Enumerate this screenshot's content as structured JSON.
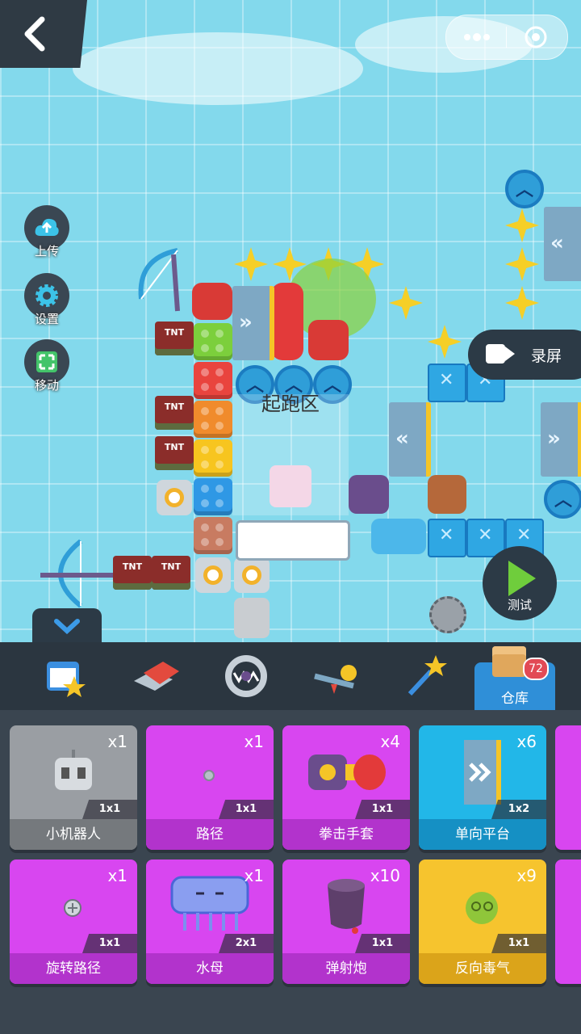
{
  "colors": {
    "sky": "#83d9ec",
    "panel_dark": "#2b3640",
    "card_gray": "#9a9ea3",
    "card_magenta": "#d846f0",
    "card_cyan": "#22b7e8",
    "card_yellow": "#f6c42e",
    "warehouse_blue": "#2f8fd8",
    "play_green": "#6fcd3c"
  },
  "top_bar": {
    "back_icon": "chevron-left-icon",
    "more_icon": "more-dots-icon",
    "close_icon": "target-circle-icon"
  },
  "side_menu": [
    {
      "label": "上传",
      "icon": "cloud-upload-icon"
    },
    {
      "label": "设置",
      "icon": "gear-icon"
    },
    {
      "label": "移动",
      "icon": "move-arrows-icon"
    }
  ],
  "board": {
    "start_zone_label": "起跑区",
    "tnt_text": "TNT"
  },
  "record_button": {
    "label": "录屏",
    "icon": "video-camera-icon"
  },
  "test_button": {
    "label": "测试",
    "icon": "play-icon"
  },
  "toolbar": {
    "tabs": [
      {
        "icon": "calendar-star-icon"
      },
      {
        "icon": "eraser-block-icon"
      },
      {
        "icon": "trap-jaw-icon"
      },
      {
        "icon": "seesaw-ball-icon"
      },
      {
        "icon": "magic-wand-icon"
      }
    ],
    "warehouse_label": "仓库",
    "warehouse_count": "72"
  },
  "inventory": [
    {
      "name": "小机器人",
      "qty": "x1",
      "size": "1x1",
      "color": "#9a9ea3",
      "icon": "robot-icon"
    },
    {
      "name": "路径",
      "qty": "x1",
      "size": "1x1",
      "color": "#d846f0",
      "icon": "path-dot-icon"
    },
    {
      "name": "拳击手套",
      "qty": "x4",
      "size": "1x1",
      "color": "#d846f0",
      "icon": "boxing-glove-icon"
    },
    {
      "name": "单向平台",
      "qty": "x6",
      "size": "1x2",
      "color": "#22b7e8",
      "icon": "one-way-platform-icon"
    },
    {
      "name": "旋转路径",
      "qty": "x1",
      "size": "1x1",
      "color": "#d846f0",
      "icon": "rotate-path-icon"
    },
    {
      "name": "水母",
      "qty": "x1",
      "size": "2x1",
      "color": "#d846f0",
      "icon": "jellyfish-icon"
    },
    {
      "name": "弹射炮",
      "qty": "x10",
      "size": "1x1",
      "color": "#d846f0",
      "icon": "cannon-icon"
    },
    {
      "name": "反向毒气",
      "qty": "x9",
      "size": "1x1",
      "color": "#f6c42e",
      "icon": "poison-gas-icon"
    }
  ]
}
